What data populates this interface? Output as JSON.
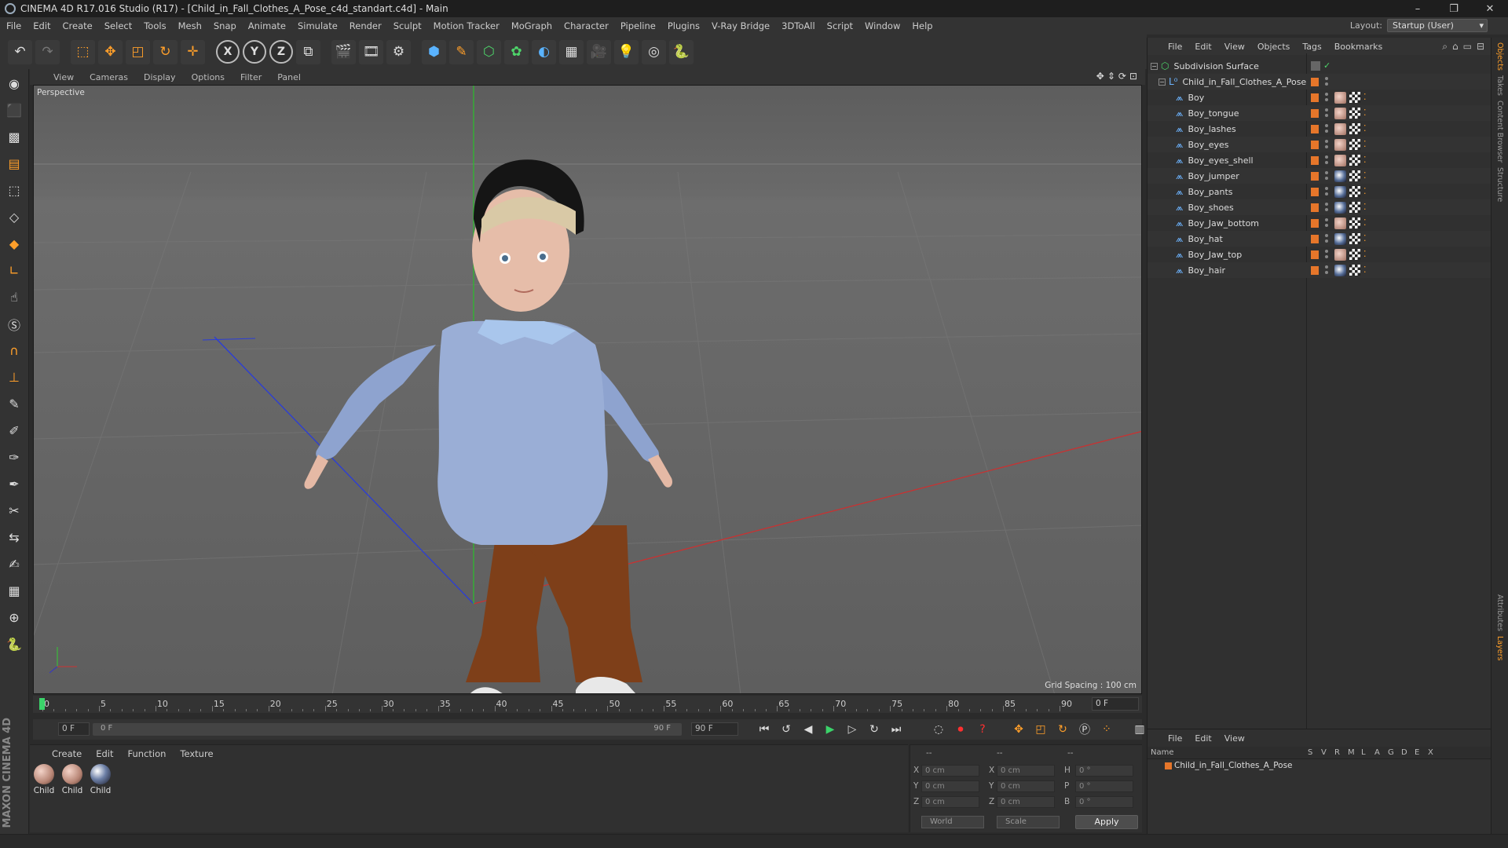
{
  "window": {
    "title": "CINEMA 4D R17.016 Studio (R17) - [Child_in_Fall_Clothes_A_Pose_c4d_standart.c4d] - Main",
    "controls": [
      "–",
      "❐",
      "✕"
    ]
  },
  "menubar": {
    "items": [
      "File",
      "Edit",
      "Create",
      "Select",
      "Tools",
      "Mesh",
      "Snap",
      "Animate",
      "Simulate",
      "Render",
      "Sculpt",
      "Motion Tracker",
      "MoGraph",
      "Character",
      "Pipeline",
      "Plugins",
      "V-Ray Bridge",
      "3DToAll",
      "Script",
      "Window",
      "Help"
    ],
    "layout_label": "Layout:",
    "layout_value": "Startup (User)"
  },
  "toolbar": {
    "axis_labels": [
      "X",
      "Y",
      "Z"
    ]
  },
  "viewport": {
    "menu": [
      "View",
      "Cameras",
      "Display",
      "Options",
      "Filter",
      "Panel"
    ],
    "camera_label": "Perspective",
    "grid_spacing": "Grid Spacing : 100 cm"
  },
  "timeline": {
    "ticks": [
      "0",
      "5",
      "10",
      "15",
      "20",
      "25",
      "30",
      "35",
      "40",
      "45",
      "50",
      "55",
      "60",
      "65",
      "70",
      "75",
      "80",
      "85",
      "90"
    ],
    "current_frame": "0 F",
    "start_field": "0 F",
    "range_start": "0 F",
    "range_end": "90 F",
    "end_field": "90 F"
  },
  "material_manager": {
    "menu": [
      "Create",
      "Edit",
      "Function",
      "Texture"
    ],
    "materials": [
      {
        "label": "Child"
      },
      {
        "label": "Child"
      },
      {
        "label": "Child"
      }
    ]
  },
  "coordinates": {
    "header": [
      "--",
      "--",
      "--"
    ],
    "rows": [
      {
        "axis": "X",
        "pos": "0 cm",
        "axis2": "X",
        "size": "0 cm",
        "axis3": "H",
        "rot": "0 °"
      },
      {
        "axis": "Y",
        "pos": "0 cm",
        "axis2": "Y",
        "size": "0 cm",
        "axis3": "P",
        "rot": "0 °"
      },
      {
        "axis": "Z",
        "pos": "0 cm",
        "axis2": "Z",
        "size": "0 cm",
        "axis3": "B",
        "rot": "0 °"
      }
    ],
    "world_dropdown": "World",
    "scale_dropdown": "Scale",
    "apply": "Apply"
  },
  "object_manager": {
    "menu": [
      "File",
      "Edit",
      "View",
      "Objects",
      "Tags",
      "Bookmarks"
    ],
    "root": "Subdivision Surface",
    "group": "Child_in_Fall_Clothes_A_Pose",
    "objects": [
      {
        "name": "Boy",
        "tag": "skin"
      },
      {
        "name": "Boy_tongue",
        "tag": "skin"
      },
      {
        "name": "Boy_lashes",
        "tag": "skin"
      },
      {
        "name": "Boy_eyes",
        "tag": "skin"
      },
      {
        "name": "Boy_eyes_shell",
        "tag": "skin"
      },
      {
        "name": "Boy_jumper",
        "tag": "cloth"
      },
      {
        "name": "Boy_pants",
        "tag": "cloth"
      },
      {
        "name": "Boy_shoes",
        "tag": "cloth"
      },
      {
        "name": "Boy_Jaw_bottom",
        "tag": "skin"
      },
      {
        "name": "Boy_hat",
        "tag": "cloth"
      },
      {
        "name": "Boy_Jaw_top",
        "tag": "skin"
      },
      {
        "name": "Boy_hair",
        "tag": "cloth"
      }
    ]
  },
  "attribute_manager": {
    "menu": [
      "File",
      "Edit",
      "View"
    ],
    "columns": [
      "Name",
      "S",
      "V",
      "R",
      "M",
      "L",
      "A",
      "G",
      "D",
      "E",
      "X"
    ],
    "row_name": "Child_in_Fall_Clothes_A_Pose"
  },
  "right_tabs": [
    "Objects",
    "Takes",
    "Content Browser",
    "Structure",
    "Attributes",
    "Layers"
  ],
  "maxon_logo": "MAXON CINEMA 4D"
}
